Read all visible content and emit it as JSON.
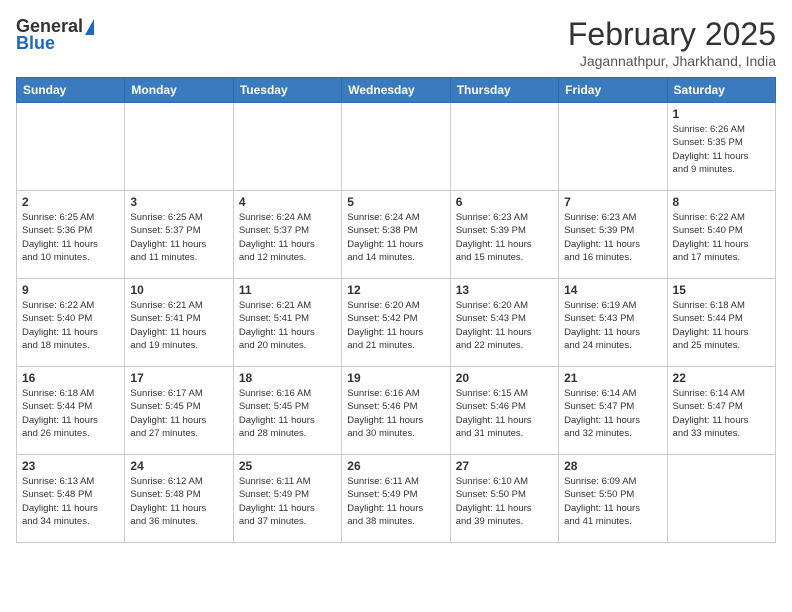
{
  "logo": {
    "general": "General",
    "blue": "Blue"
  },
  "title": "February 2025",
  "location": "Jagannathpur, Jharkhand, India",
  "weekdays": [
    "Sunday",
    "Monday",
    "Tuesday",
    "Wednesday",
    "Thursday",
    "Friday",
    "Saturday"
  ],
  "weeks": [
    [
      {
        "day": "",
        "info": ""
      },
      {
        "day": "",
        "info": ""
      },
      {
        "day": "",
        "info": ""
      },
      {
        "day": "",
        "info": ""
      },
      {
        "day": "",
        "info": ""
      },
      {
        "day": "",
        "info": ""
      },
      {
        "day": "1",
        "info": "Sunrise: 6:26 AM\nSunset: 5:35 PM\nDaylight: 11 hours\nand 9 minutes."
      }
    ],
    [
      {
        "day": "2",
        "info": "Sunrise: 6:25 AM\nSunset: 5:36 PM\nDaylight: 11 hours\nand 10 minutes."
      },
      {
        "day": "3",
        "info": "Sunrise: 6:25 AM\nSunset: 5:37 PM\nDaylight: 11 hours\nand 11 minutes."
      },
      {
        "day": "4",
        "info": "Sunrise: 6:24 AM\nSunset: 5:37 PM\nDaylight: 11 hours\nand 12 minutes."
      },
      {
        "day": "5",
        "info": "Sunrise: 6:24 AM\nSunset: 5:38 PM\nDaylight: 11 hours\nand 14 minutes."
      },
      {
        "day": "6",
        "info": "Sunrise: 6:23 AM\nSunset: 5:39 PM\nDaylight: 11 hours\nand 15 minutes."
      },
      {
        "day": "7",
        "info": "Sunrise: 6:23 AM\nSunset: 5:39 PM\nDaylight: 11 hours\nand 16 minutes."
      },
      {
        "day": "8",
        "info": "Sunrise: 6:22 AM\nSunset: 5:40 PM\nDaylight: 11 hours\nand 17 minutes."
      }
    ],
    [
      {
        "day": "9",
        "info": "Sunrise: 6:22 AM\nSunset: 5:40 PM\nDaylight: 11 hours\nand 18 minutes."
      },
      {
        "day": "10",
        "info": "Sunrise: 6:21 AM\nSunset: 5:41 PM\nDaylight: 11 hours\nand 19 minutes."
      },
      {
        "day": "11",
        "info": "Sunrise: 6:21 AM\nSunset: 5:41 PM\nDaylight: 11 hours\nand 20 minutes."
      },
      {
        "day": "12",
        "info": "Sunrise: 6:20 AM\nSunset: 5:42 PM\nDaylight: 11 hours\nand 21 minutes."
      },
      {
        "day": "13",
        "info": "Sunrise: 6:20 AM\nSunset: 5:43 PM\nDaylight: 11 hours\nand 22 minutes."
      },
      {
        "day": "14",
        "info": "Sunrise: 6:19 AM\nSunset: 5:43 PM\nDaylight: 11 hours\nand 24 minutes."
      },
      {
        "day": "15",
        "info": "Sunrise: 6:18 AM\nSunset: 5:44 PM\nDaylight: 11 hours\nand 25 minutes."
      }
    ],
    [
      {
        "day": "16",
        "info": "Sunrise: 6:18 AM\nSunset: 5:44 PM\nDaylight: 11 hours\nand 26 minutes."
      },
      {
        "day": "17",
        "info": "Sunrise: 6:17 AM\nSunset: 5:45 PM\nDaylight: 11 hours\nand 27 minutes."
      },
      {
        "day": "18",
        "info": "Sunrise: 6:16 AM\nSunset: 5:45 PM\nDaylight: 11 hours\nand 28 minutes."
      },
      {
        "day": "19",
        "info": "Sunrise: 6:16 AM\nSunset: 5:46 PM\nDaylight: 11 hours\nand 30 minutes."
      },
      {
        "day": "20",
        "info": "Sunrise: 6:15 AM\nSunset: 5:46 PM\nDaylight: 11 hours\nand 31 minutes."
      },
      {
        "day": "21",
        "info": "Sunrise: 6:14 AM\nSunset: 5:47 PM\nDaylight: 11 hours\nand 32 minutes."
      },
      {
        "day": "22",
        "info": "Sunrise: 6:14 AM\nSunset: 5:47 PM\nDaylight: 11 hours\nand 33 minutes."
      }
    ],
    [
      {
        "day": "23",
        "info": "Sunrise: 6:13 AM\nSunset: 5:48 PM\nDaylight: 11 hours\nand 34 minutes."
      },
      {
        "day": "24",
        "info": "Sunrise: 6:12 AM\nSunset: 5:48 PM\nDaylight: 11 hours\nand 36 minutes."
      },
      {
        "day": "25",
        "info": "Sunrise: 6:11 AM\nSunset: 5:49 PM\nDaylight: 11 hours\nand 37 minutes."
      },
      {
        "day": "26",
        "info": "Sunrise: 6:11 AM\nSunset: 5:49 PM\nDaylight: 11 hours\nand 38 minutes."
      },
      {
        "day": "27",
        "info": "Sunrise: 6:10 AM\nSunset: 5:50 PM\nDaylight: 11 hours\nand 39 minutes."
      },
      {
        "day": "28",
        "info": "Sunrise: 6:09 AM\nSunset: 5:50 PM\nDaylight: 11 hours\nand 41 minutes."
      },
      {
        "day": "",
        "info": ""
      }
    ]
  ]
}
